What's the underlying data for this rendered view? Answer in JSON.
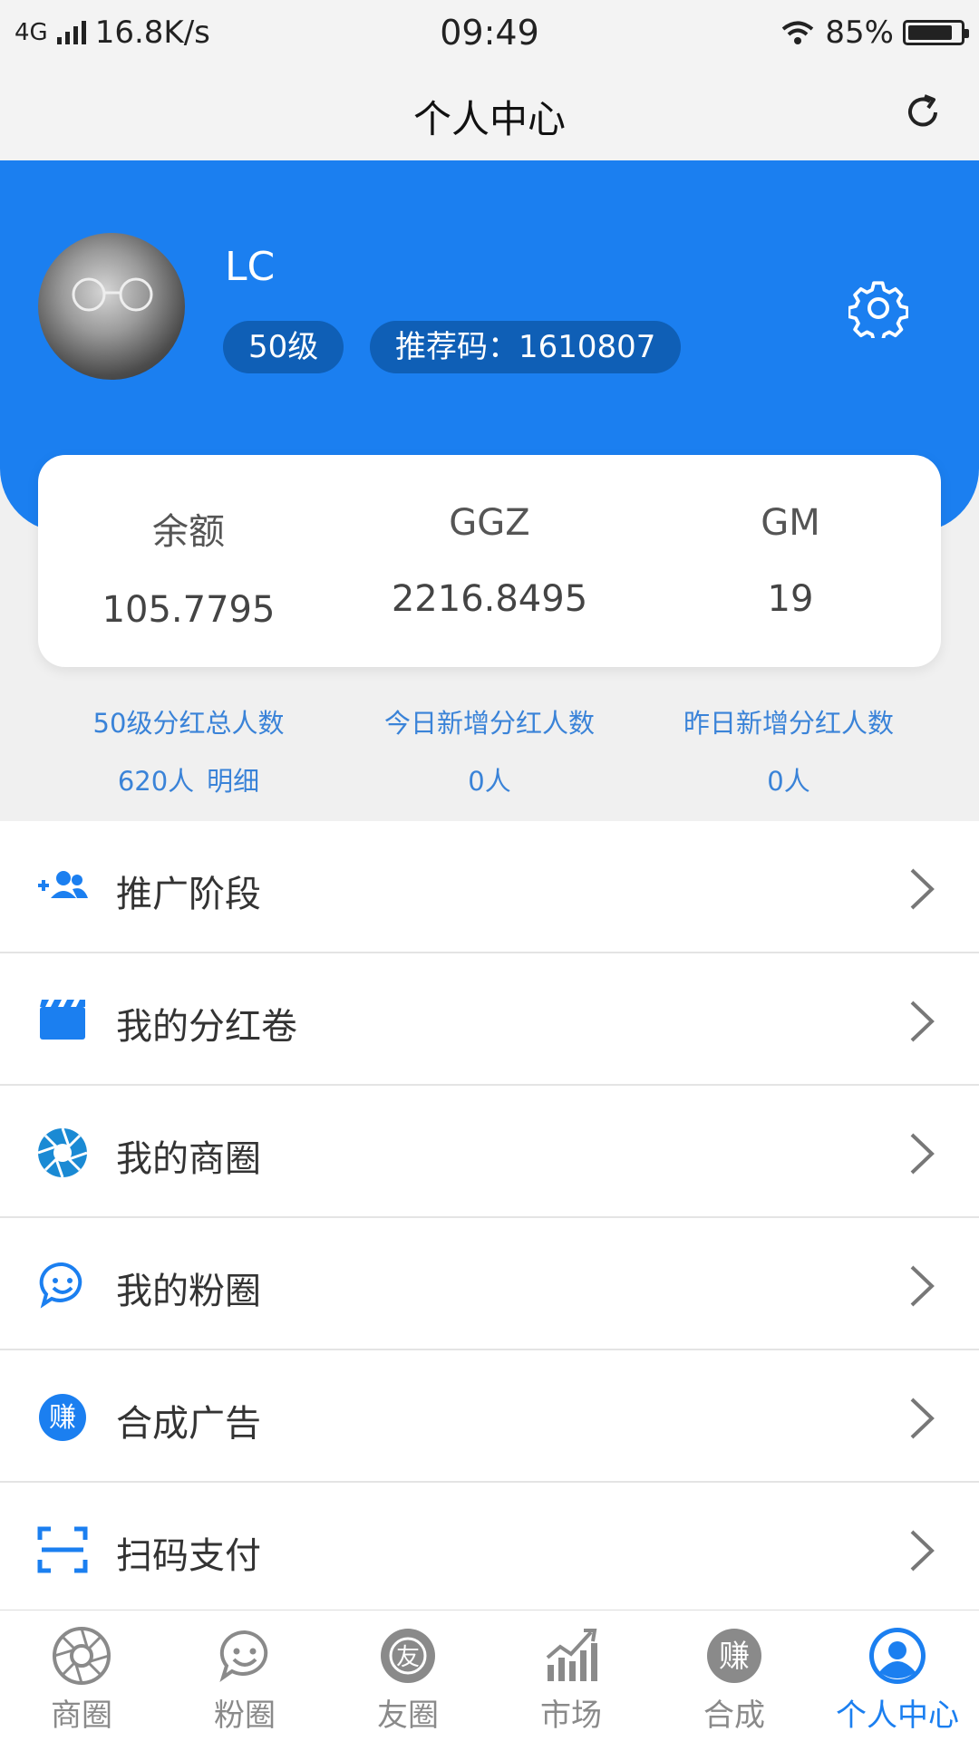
{
  "status_bar": {
    "network": "4G",
    "speed": "16.8K/s",
    "time": "09:49",
    "battery": "85%",
    "battery_level": 0.85
  },
  "title_bar": {
    "title": "个人中心"
  },
  "profile": {
    "name": "LC",
    "level": "50级",
    "referral": "推荐码：1610807"
  },
  "balances": [
    {
      "label": "余额",
      "value": "105.7795"
    },
    {
      "label": "GGZ",
      "value": "2216.8495"
    },
    {
      "label": "GM",
      "value": "19"
    }
  ],
  "dividend_stats": [
    {
      "label": "50级分红总人数",
      "value": "620人",
      "link": "明细"
    },
    {
      "label": "今日新增分红人数",
      "value": "0人"
    },
    {
      "label": "昨日新增分红人数",
      "value": "0人"
    }
  ],
  "menu": [
    {
      "label": "推广阶段",
      "icon": "add-group-icon"
    },
    {
      "label": "我的分红卷",
      "icon": "clapper-icon"
    },
    {
      "label": "我的商圈",
      "icon": "aperture-icon"
    },
    {
      "label": "我的粉圈",
      "icon": "smile-chat-icon"
    },
    {
      "label": "合成广告",
      "icon": "earn-badge-icon"
    },
    {
      "label": "扫码支付",
      "icon": "scan-icon"
    }
  ],
  "tabs": [
    {
      "label": "商圈",
      "icon": "aperture-icon"
    },
    {
      "label": "粉圈",
      "icon": "smile-chat-icon"
    },
    {
      "label": "友圈",
      "icon": "friend-badge-icon",
      "glyph": "友"
    },
    {
      "label": "市场",
      "icon": "chart-icon"
    },
    {
      "label": "合成",
      "icon": "earn-badge-icon",
      "glyph": "赚"
    },
    {
      "label": "个人中心",
      "icon": "user-icon",
      "active": true
    }
  ],
  "colors": {
    "primary": "#1b7ff0",
    "badge": "#0f5fb6",
    "stat_text": "#3a83d8"
  },
  "menu_glyphs": {
    "earn": "赚"
  }
}
